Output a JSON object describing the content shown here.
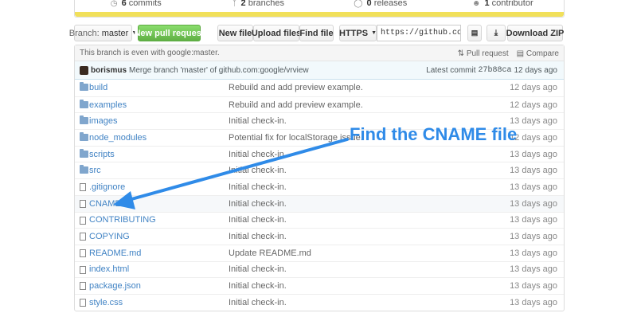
{
  "summary": {
    "commits": "6",
    "commits_label": "commits",
    "branches": "2",
    "branches_label": "branches",
    "releases": "0",
    "releases_label": "releases",
    "contributors": "1",
    "contributors_label": "contributor"
  },
  "toolbar": {
    "branch_prefix": "Branch:",
    "branch_name": "master",
    "new_pull_request": "New pull request",
    "new_file": "New file",
    "upload_files": "Upload files",
    "find_file": "Find file",
    "protocol": "HTTPS",
    "clone_url": "https://github.com/patcat",
    "download_zip": "Download ZIP"
  },
  "branch_info": {
    "text": "This branch is even with google:master.",
    "pull_request": "Pull request",
    "compare": "Compare"
  },
  "commit": {
    "author": "borismus",
    "message": "Merge branch 'master' of github.com:google/vrview",
    "latest_label": "Latest commit",
    "sha": "27b88ca",
    "age": "12 days ago"
  },
  "files": [
    {
      "name": "build",
      "type": "dir",
      "message": "Rebuild and add preview example.",
      "age": "12 days ago"
    },
    {
      "name": "examples",
      "type": "dir",
      "message": "Rebuild and add preview example.",
      "age": "12 days ago"
    },
    {
      "name": "images",
      "type": "dir",
      "message": "Initial check-in.",
      "age": "13 days ago"
    },
    {
      "name": "node_modules",
      "type": "dir",
      "message": "Potential fix for localStorage issue.",
      "age": "12 days ago"
    },
    {
      "name": "scripts",
      "type": "dir",
      "message": "Initial check-in.",
      "age": "13 days ago"
    },
    {
      "name": "src",
      "type": "dir",
      "message": "Initial check-in.",
      "age": "13 days ago"
    },
    {
      "name": ".gitignore",
      "type": "file",
      "message": "Initial check-in.",
      "age": "13 days ago"
    },
    {
      "name": "CNAME",
      "type": "file",
      "message": "Initial check-in.",
      "age": "13 days ago"
    },
    {
      "name": "CONTRIBUTING",
      "type": "file",
      "message": "Initial check-in.",
      "age": "13 days ago"
    },
    {
      "name": "COPYING",
      "type": "file",
      "message": "Initial check-in.",
      "age": "13 days ago"
    },
    {
      "name": "README.md",
      "type": "file",
      "message": "Update README.md",
      "age": "13 days ago"
    },
    {
      "name": "index.html",
      "type": "file",
      "message": "Initial check-in.",
      "age": "13 days ago"
    },
    {
      "name": "package.json",
      "type": "file",
      "message": "Initial check-in.",
      "age": "13 days ago"
    },
    {
      "name": "style.css",
      "type": "file",
      "message": "Initial check-in.",
      "age": "13 days ago"
    }
  ],
  "annotation": {
    "text": "Find the CNAME file",
    "color": "#2f8be8"
  },
  "colors": {
    "link": "#4183c4",
    "language_bar": "#f1e05a",
    "green_button": "#60b044"
  }
}
